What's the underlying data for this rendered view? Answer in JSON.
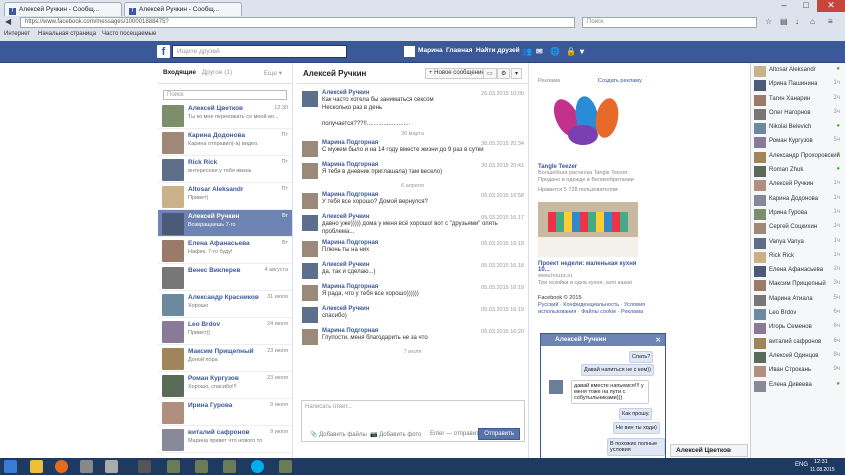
{
  "browser": {
    "tabs": [
      "Алексей Ручкин - Сообщ...",
      "Алексей Ручкин - Сообщ..."
    ],
    "url": "https://www.facebook.com/messages/100001888475?",
    "search_placeholder": "Поиск",
    "bookmarks": [
      "Интернет",
      "Начальная страница",
      "Часто посещаемые"
    ]
  },
  "fb": {
    "search_placeholder": "Ищите друзей",
    "nav": [
      "Марина",
      "Главная",
      "Найти друзей"
    ]
  },
  "left": {
    "tab_inbox": "Входящие",
    "tab_other": "Другое (1)",
    "more": "Еще ▾",
    "search_placeholder": "Поиск",
    "convos": [
      {
        "name": "Алексей Цветков",
        "preview": "Ты ко мне переезжать со мной во...",
        "date": "12:30"
      },
      {
        "name": "Карина Додонова",
        "preview": "Карина отправил(-а) видео.",
        "date": "Пт"
      },
      {
        "name": "Rick Rick",
        "preview": "интересная у тебя жизнь",
        "date": "Пт"
      },
      {
        "name": "Altosar Aleksandr",
        "preview": "Привет)",
        "date": "Пт"
      },
      {
        "name": "Алексей Ручкин",
        "preview": "Возвращаешь 7-го",
        "date": "Вт"
      },
      {
        "name": "Елена Афанасьева",
        "preview": "Нафик. 7-го буду!",
        "date": "Вт"
      },
      {
        "name": "Венес Виклерев",
        "preview": "",
        "date": "4 августа"
      },
      {
        "name": "Александр Красников",
        "preview": "Хорошо",
        "date": "31 июля"
      },
      {
        "name": "Leo Brdov",
        "preview": "Привет))",
        "date": "24 июля"
      },
      {
        "name": "Максим Прищепный",
        "preview": "Доной пора",
        "date": "23 июля"
      },
      {
        "name": "Роман Кургузов",
        "preview": "Хорошо, спасибо!!!",
        "date": "23 июля"
      },
      {
        "name": "Ирина Гурова",
        "preview": "",
        "date": "9 июля"
      },
      {
        "name": "виталий сафронов",
        "preview": "Марина привет что нового то",
        "date": "9 июля"
      }
    ]
  },
  "thread": {
    "title": "Алексей Ручкин",
    "new_msg": "+ Новое сообщение",
    "messages": [
      {
        "name": "Алексей Ручкин",
        "text": "Как часто хотела бы заниматься сексом\nНесколько раз в день\n\nполучается???!!..........................",
        "time": "26.03.2015 10:00"
      },
      {
        "sep": "30 марта"
      },
      {
        "name": "Марина Подгорная",
        "text": "С мужем было и на 14 году вместе жизни до 9 раз в сутки",
        "time": "30.03.2015 20:34"
      },
      {
        "name": "Марина Подгорная",
        "text": "Я тебя в дневник приглашала) там весело)",
        "time": "30.03.2015 20:41"
      },
      {
        "sep": "6 апреля"
      },
      {
        "name": "Марина Подгорная",
        "text": "У тебя все хорошо? Домой вернулся?",
        "time": "05.03.2015 16:58"
      },
      {
        "name": "Алексей Ручкин",
        "text": "давно уже))))) дома у меня всё хорошо! вот с \"друзьями\" опять проблема...",
        "time": "05.03.2015 16:17"
      },
      {
        "name": "Марина Подгорная",
        "text": "Плюнь ты на них",
        "time": "05.03.2015 16:18"
      },
      {
        "name": "Алексей Ручкин",
        "text": "да, так и сделаю...)",
        "time": "05.03.2015 16:18"
      },
      {
        "name": "Марина Подгорная",
        "text": "Я рада, что у тебя все хорошо))))))",
        "time": "05.03.2015 16:19"
      },
      {
        "name": "Алексей Ручкин",
        "text": "спасибо)",
        "time": "05.03.2015 16:19"
      },
      {
        "name": "Марина Подгорная",
        "text": "Глупости, меня благодарить не за что",
        "time": "05.03.2015 16:20"
      },
      {
        "sep": "7 июля"
      }
    ],
    "compose_placeholder": "Написать ответ...",
    "add_files": "Добавить файлы",
    "add_photo": "Добавить фото",
    "enter_send": "Enter — отправить",
    "send": "Отправить"
  },
  "ads": {
    "header": "Реклама",
    "create": "Создать рекламу",
    "ad1_title": "Tangle Teezer",
    "ad1_text": "Волшебная расческа Tangle Teezer. Продано в одежде в Великобритании",
    "ad1_likes": "Нравится 5 728 пользователям",
    "ad2_title": "Проект недели: маленькая кухня 10...",
    "ad2_url": "www.houzz.ru",
    "ad2_text": "Три хозяйки и одна кухня, зато какая",
    "footer": "Facebook © 2015",
    "links": "Русский · Конфиденциальность · Условия использования · Файлы cookie · Реклама"
  },
  "chat": {
    "title": "Алексей Ручкин",
    "bubbles": [
      "Спать?",
      "Давай напиться не с кем))",
      "давай вместе напьемся!!! у меня тоже на пути с собутыльниками)))",
      "Как прошу.",
      "Не вин ты ходи)",
      "В похожих полные условия"
    ],
    "second": "Алексей Цветков"
  },
  "sidebar": {
    "contacts": [
      {
        "name": "Altosar Aleksandr",
        "status": "●"
      },
      {
        "name": "Ирина Пашинина",
        "status": "1ч"
      },
      {
        "name": "Тагин Ханарин",
        "status": "2ч"
      },
      {
        "name": "Олег Нагорнов",
        "status": "3ч"
      },
      {
        "name": "Nikolai Belevich",
        "status": "●"
      },
      {
        "name": "Роман Кургузов",
        "status": "5ч"
      },
      {
        "name": "Александр Прохоровский",
        "status": "●"
      },
      {
        "name": "Roman Zhuk",
        "status": "●"
      },
      {
        "name": "Алексей Ручкин",
        "status": "1ч"
      },
      {
        "name": "Карина Додонова",
        "status": "1ч"
      },
      {
        "name": "Ирина Гурова",
        "status": "1ч"
      },
      {
        "name": "Сергей Соцкихин",
        "status": "1ч"
      },
      {
        "name": "Vanya Vanya",
        "status": "1ч"
      },
      {
        "name": "Rick Rick",
        "status": "1ч"
      },
      {
        "name": "Елена Афанасьева",
        "status": "2ч"
      },
      {
        "name": "Максим Прищепный",
        "status": "3ч"
      },
      {
        "name": "Марина Атиала",
        "status": "5ч"
      },
      {
        "name": "Leo Brdov",
        "status": "6ч"
      },
      {
        "name": "Игорь Семенов",
        "status": "6ч"
      },
      {
        "name": "виталий сафронов",
        "status": "6ч"
      },
      {
        "name": "Алексей Одинцов",
        "status": "8ч"
      },
      {
        "name": "Иван Строкань",
        "status": "9ч"
      },
      {
        "name": "Елена Дивеева",
        "status": "●"
      }
    ]
  },
  "taskbar": {
    "lang": "ENG",
    "time": "12:31",
    "date": "11.08.2015"
  }
}
